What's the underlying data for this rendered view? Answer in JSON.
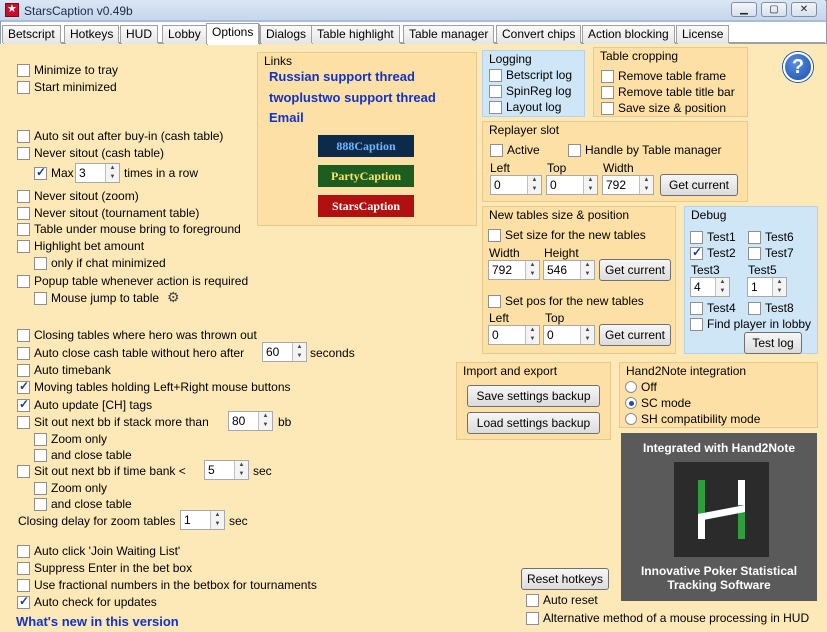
{
  "window": {
    "title": "StarsCaption v0.49b",
    "min": "▁",
    "max": "▢",
    "close": "✕"
  },
  "tabs": [
    "Betscript",
    "Hotkeys",
    "HUD",
    "Lobby",
    "Options",
    "Dialogs",
    "Table highlight",
    "Table manager",
    "Convert chips",
    "Action blocking",
    "License"
  ],
  "left": {
    "minimize_tray": "Minimize to tray",
    "start_minimized": "Start minimized",
    "auto_sitout": "Auto sit out after buy-in (cash table)",
    "never_sitout_cash": "Never sitout (cash table)",
    "max_label": "Max",
    "max_value": "3",
    "times_in_row": "times in a row",
    "never_sitout_zoom": "Never sitout (zoom)",
    "never_sitout_tourn": "Never sitout (tournament table)",
    "table_under_mouse": "Table under mouse bring to foreground",
    "highlight_bet": "Highlight bet amount",
    "only_chat_min": "only if chat minimized",
    "popup_table": "Popup table whenever action is required",
    "mouse_jump": "Mouse jump to table",
    "closing_thrown": "Closing tables where hero was thrown out",
    "auto_close_cash": "Auto close cash table without hero after",
    "auto_close_value": "60",
    "seconds": "seconds",
    "auto_timebank": "Auto timebank",
    "moving_tables": "Moving tables holding Left+Right mouse buttons",
    "auto_update_ch": "Auto update [CH] tags",
    "sit_out_stack": "Sit out next bb if stack more than",
    "stack_value": "80",
    "bb": "bb",
    "zoom_only": "Zoom only",
    "and_close": "and close table",
    "sit_out_timebank": "Sit out next bb if time bank <",
    "timebank_value": "5",
    "sec": "sec",
    "zoom_only2": "Zoom only",
    "and_close2": "and close table",
    "closing_delay": "Closing delay for zoom tables",
    "closing_delay_value": "1",
    "sec2": "sec",
    "auto_click_join": "Auto click 'Join Waiting List'",
    "suppress_enter": "Suppress Enter in the bet box",
    "fractional": "Use fractional numbers in the betbox for tournaments",
    "auto_check_updates": "Auto check for updates",
    "whats_new": "What's new in this version"
  },
  "links": {
    "title": "Links",
    "russian": "Russian support thread",
    "twoplustwo": "twoplustwo support thread",
    "email": "Email",
    "brands": [
      "888Caption",
      "PartyCaption",
      "StarsCaption"
    ]
  },
  "logging": {
    "title": "Logging",
    "betscript": "Betscript log",
    "spinreg": "SpinReg log",
    "layout": "Layout log"
  },
  "cropping": {
    "title": "Table cropping",
    "frame": "Remove table frame",
    "titlebar": "Remove table title bar",
    "save": "Save size & position"
  },
  "replayer": {
    "title": "Replayer slot",
    "active": "Active",
    "handle": "Handle by Table manager",
    "left": "Left",
    "top": "Top",
    "width": "Width",
    "left_val": "0",
    "top_val": "0",
    "width_val": "792",
    "get_current": "Get current"
  },
  "newtables": {
    "title": "New tables size & position",
    "set_size": "Set size for the new tables",
    "width": "Width",
    "height": "Height",
    "width_val": "792",
    "height_val": "546",
    "get_current": "Get current",
    "set_pos": "Set pos for the new tables",
    "left": "Left",
    "top": "Top",
    "left_val": "0",
    "top_val": "0",
    "get_current2": "Get current"
  },
  "debug": {
    "title": "Debug",
    "test1": "Test1",
    "test2": "Test2",
    "test3": "Test3",
    "test4": "Test4",
    "test5": "Test5",
    "test6": "Test6",
    "test7": "Test7",
    "test8": "Test8",
    "test3_val": "4",
    "test5_val": "1",
    "find_player": "Find player in lobby",
    "test_log": "Test log"
  },
  "import": {
    "title": "Import and export",
    "save": "Save settings backup",
    "load": "Load settings backup"
  },
  "h2n": {
    "title": "Hand2Note integration",
    "off": "Off",
    "sc": "SC mode",
    "sh": "SH compatibility mode",
    "banner_top": "Integrated with Hand2Note",
    "banner_bottom_1": "Innovative Poker Statistical",
    "banner_bottom_2": "Tracking Software"
  },
  "bottom": {
    "reset_hotkeys": "Reset hotkeys",
    "auto_reset": "Auto reset",
    "alt_method": "Alternative method of a mouse processing in HUD"
  },
  "colors": {
    "blue_panel": "#cfe6f7",
    "orange_panel": "#fde9b8",
    "link_blue": "#1232c8",
    "brand_888": "#0c2a4a",
    "brand_party": "#1b5e20",
    "brand_stars": "#b01010"
  }
}
